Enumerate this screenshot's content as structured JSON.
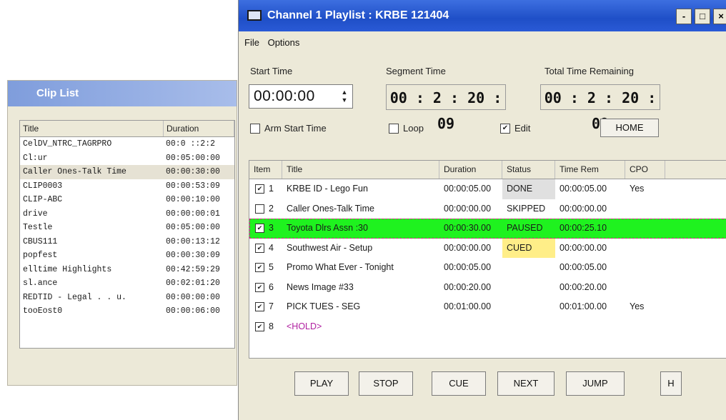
{
  "clip_list": {
    "title": "Clip List",
    "columns": [
      "Title",
      "Duration"
    ],
    "rows": [
      {
        "title": "CelDV_NTRC_TAGRPRO",
        "duration": "00:0 ::2:2"
      },
      {
        "title": "Cl:ur",
        "duration": "00:05:00:00"
      },
      {
        "title": "Caller Ones-Talk Time",
        "duration": "00:00:30:00"
      },
      {
        "title": "CLIP0003",
        "duration": "00:00:53:09"
      },
      {
        "title": "CLIP-ABC",
        "duration": "00:00:10:00"
      },
      {
        "title": "drive",
        "duration": "00:00:00:01"
      },
      {
        "title": "Testle",
        "duration": "00:05:00:00"
      },
      {
        "title": "CBUS111",
        "duration": "00:00:13:12"
      },
      {
        "title": "popfest",
        "duration": "00:00:30:09"
      },
      {
        "title": "  elltime Highlights",
        "duration": "00:42:59:29"
      },
      {
        "title": "sl.ance",
        "duration": "00:02:01:20"
      },
      {
        "title": "REDTID - Legal . . u.",
        "duration": "00:00:00:00"
      },
      {
        "title": "tooEost0",
        "duration": "00:00:06:00"
      }
    ]
  },
  "playlist": {
    "title": "Channel 1 Playlist : KRBE 121404",
    "window_buttons": {
      "minimize": "-",
      "maximize": "□",
      "close": "×"
    },
    "menu": [
      "File",
      "Options"
    ],
    "start_time": {
      "label": "Start Time",
      "value": "00:00:00"
    },
    "segment_time": {
      "label": "Segment Time",
      "value": "00 : 2 : 20 : 09"
    },
    "total_remaining": {
      "label": "Total Time Remaining",
      "value": "00 : 2 : 20 : 09"
    },
    "checkboxes": [
      {
        "label": "Arm Start Time",
        "checked": false
      },
      {
        "label": "Loop",
        "checked": false
      },
      {
        "label": "Edit",
        "checked": true
      }
    ],
    "home_label": "HOME",
    "columns": [
      "Item",
      "Title",
      "Duration",
      "Status",
      "Time Rem",
      "CPO"
    ],
    "rows": [
      {
        "item": "1",
        "checked": true,
        "title": "KRBE ID - Lego Fun",
        "duration": "00:00:05.00",
        "status": "DONE",
        "time_rem": "00:00:05.00",
        "cpo": "Yes"
      },
      {
        "item": "2",
        "checked": false,
        "title": "Caller Ones-Talk Time",
        "duration": "00:00:00.00",
        "status": "SKIPPED",
        "time_rem": "00:00:00.00",
        "cpo": ""
      },
      {
        "item": "3",
        "checked": true,
        "title": "Toyota Dlrs Assn :30",
        "duration": "00:00:30.00",
        "status": "PAUSED",
        "time_rem": "00:00:25.10",
        "cpo": ""
      },
      {
        "item": "4",
        "checked": true,
        "title": "Southwest Air - Setup",
        "duration": "00:00:00.00",
        "status": "CUED",
        "time_rem": "00:00:00.00",
        "cpo": ""
      },
      {
        "item": "5",
        "checked": true,
        "title": "Promo What Ever - Tonight",
        "duration": "00:00:05.00",
        "status": "",
        "time_rem": "00:00:05.00",
        "cpo": ""
      },
      {
        "item": "6",
        "checked": true,
        "title": "News Image #33",
        "duration": "00:00:20.00",
        "status": "",
        "time_rem": "00:00:20.00",
        "cpo": ""
      },
      {
        "item": "7",
        "checked": true,
        "title": "PICK TUES - SEG",
        "duration": "00:01:00.00",
        "status": "",
        "time_rem": "00:01:00.00",
        "cpo": "Yes"
      },
      {
        "item": "8",
        "checked": true,
        "title": "<HOLD>",
        "duration": "",
        "status": "",
        "time_rem": "",
        "cpo": ""
      }
    ],
    "buttons": [
      "PLAY",
      "STOP",
      "CUE",
      "NEXT",
      "JUMP",
      "H"
    ]
  }
}
